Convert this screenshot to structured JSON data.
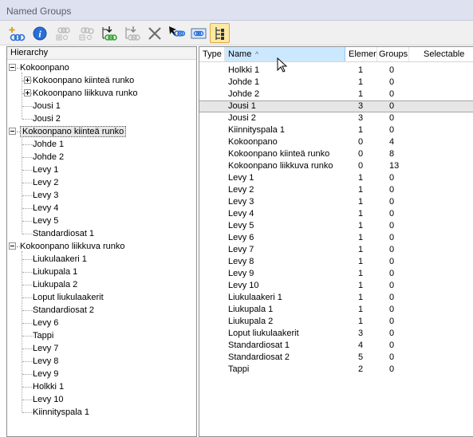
{
  "window": {
    "title": "Named Groups"
  },
  "toolbar": {
    "buttons": [
      {
        "name": "add-group-icon",
        "active": false
      },
      {
        "name": "info-icon",
        "active": false
      },
      {
        "name": "ungroup-icon",
        "active": false
      },
      {
        "name": "group-split-icon",
        "active": false
      },
      {
        "name": "move-down-group-icon",
        "active": false
      },
      {
        "name": "move-group-icon",
        "active": false
      },
      {
        "name": "delete-icon",
        "active": false
      },
      {
        "name": "select-pointer-icon",
        "active": false
      },
      {
        "name": "show-group-icon",
        "active": false
      },
      {
        "name": "hierarchy-view-icon",
        "active": true
      }
    ]
  },
  "hierarchy": {
    "header": "Hierarchy",
    "roots": [
      {
        "label": "Kokoonpano",
        "expanded": true,
        "selected": false,
        "children": [
          {
            "label": "Kokoonpano kiinteä runko",
            "expandable": true
          },
          {
            "label": "Kokoonpano liikkuva runko",
            "expandable": true
          },
          {
            "label": "Jousi 1",
            "expandable": false
          },
          {
            "label": "Jousi 2",
            "expandable": false
          }
        ]
      },
      {
        "label": "Kokoonpano kiinteä runko",
        "expanded": true,
        "selected": true,
        "children": [
          {
            "label": "Johde 1"
          },
          {
            "label": "Johde 2"
          },
          {
            "label": "Levy 1"
          },
          {
            "label": "Levy 2"
          },
          {
            "label": "Levy 3"
          },
          {
            "label": "Levy 4"
          },
          {
            "label": "Levy 5"
          },
          {
            "label": "Standardiosat 1"
          }
        ]
      },
      {
        "label": "Kokoonpano liikkuva runko",
        "expanded": true,
        "selected": false,
        "children": [
          {
            "label": "Liukulaakeri 1"
          },
          {
            "label": "Liukupala 1"
          },
          {
            "label": "Liukupala 2"
          },
          {
            "label": "Loput liukulaakerit"
          },
          {
            "label": "Standardiosat 2"
          },
          {
            "label": "Levy 6"
          },
          {
            "label": "Tappi"
          },
          {
            "label": "Levy 7"
          },
          {
            "label": "Levy 8"
          },
          {
            "label": "Levy 9"
          },
          {
            "label": "Holkki 1"
          },
          {
            "label": "Levy 10"
          },
          {
            "label": "Kiinnityspala 1"
          }
        ]
      }
    ]
  },
  "list": {
    "columns": {
      "type": "Type",
      "name": "Name",
      "elements": "Elements",
      "groups": "Groups",
      "selectable": "Selectable"
    },
    "sort_indicator": "^",
    "selected_row": 3,
    "rows": [
      {
        "name": "Holkki 1",
        "elements": "1",
        "groups": "0"
      },
      {
        "name": "Johde 1",
        "elements": "1",
        "groups": "0"
      },
      {
        "name": "Johde 2",
        "elements": "1",
        "groups": "0"
      },
      {
        "name": "Jousi 1",
        "elements": "3",
        "groups": "0"
      },
      {
        "name": "Jousi 2",
        "elements": "3",
        "groups": "0"
      },
      {
        "name": "Kiinnityspala 1",
        "elements": "1",
        "groups": "0"
      },
      {
        "name": "Kokoonpano",
        "elements": "0",
        "groups": "4"
      },
      {
        "name": "Kokoonpano kiinteä runko",
        "elements": "0",
        "groups": "8"
      },
      {
        "name": "Kokoonpano liikkuva runko",
        "elements": "0",
        "groups": "13"
      },
      {
        "name": "Levy 1",
        "elements": "1",
        "groups": "0"
      },
      {
        "name": "Levy 2",
        "elements": "1",
        "groups": "0"
      },
      {
        "name": "Levy 3",
        "elements": "1",
        "groups": "0"
      },
      {
        "name": "Levy 4",
        "elements": "1",
        "groups": "0"
      },
      {
        "name": "Levy 5",
        "elements": "1",
        "groups": "0"
      },
      {
        "name": "Levy 6",
        "elements": "1",
        "groups": "0"
      },
      {
        "name": "Levy 7",
        "elements": "1",
        "groups": "0"
      },
      {
        "name": "Levy 8",
        "elements": "1",
        "groups": "0"
      },
      {
        "name": "Levy 9",
        "elements": "1",
        "groups": "0"
      },
      {
        "name": "Levy 10",
        "elements": "1",
        "groups": "0"
      },
      {
        "name": "Liukulaakeri 1",
        "elements": "1",
        "groups": "0"
      },
      {
        "name": "Liukupala 1",
        "elements": "1",
        "groups": "0"
      },
      {
        "name": "Liukupala 2",
        "elements": "1",
        "groups": "0"
      },
      {
        "name": "Loput liukulaakerit",
        "elements": "3",
        "groups": "0"
      },
      {
        "name": "Standardiosat 1",
        "elements": "4",
        "groups": "0"
      },
      {
        "name": "Standardiosat 2",
        "elements": "5",
        "groups": "0"
      },
      {
        "name": "Tappi",
        "elements": "2",
        "groups": "0"
      }
    ]
  }
}
